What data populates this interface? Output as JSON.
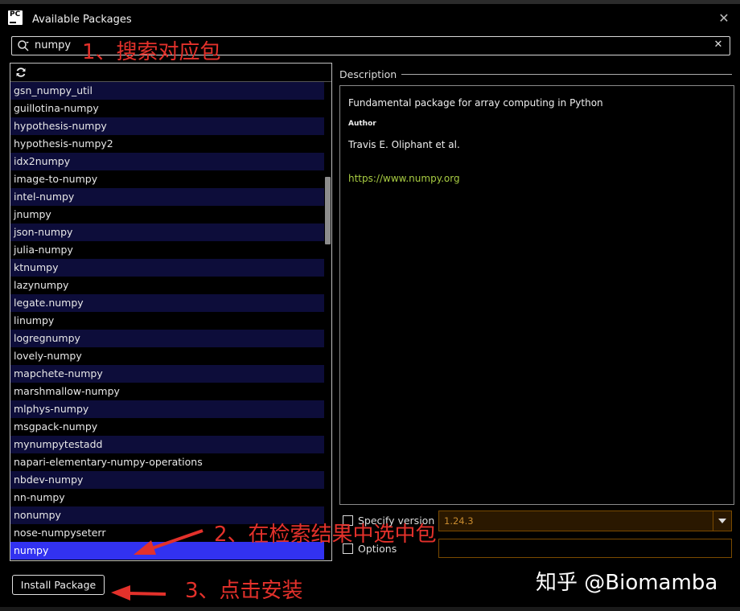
{
  "window": {
    "title": "Available Packages",
    "icon_text": "PC"
  },
  "search": {
    "value": "numpy"
  },
  "packages": [
    "gsn_numpy_util",
    "guillotina-numpy",
    "hypothesis-numpy",
    "hypothesis-numpy2",
    "idx2numpy",
    "image-to-numpy",
    "intel-numpy",
    "jnumpy",
    "json-numpy",
    "julia-numpy",
    "ktnumpy",
    "lazynumpy",
    "legate.numpy",
    "linumpy",
    "logregnumpy",
    "lovely-numpy",
    "mapchete-numpy",
    "marshmallow-numpy",
    "mlphys-numpy",
    "msgpack-numpy",
    "mynumpytestadd",
    "napari-elementary-numpy-operations",
    "nbdev-numpy",
    "nn-numpy",
    "nonumpy",
    "nose-numpyseterr",
    "numpy"
  ],
  "selected_package": "numpy",
  "description": {
    "header": "Description",
    "summary": "Fundamental package for array computing in Python",
    "author_label": "Author",
    "author": "Travis E. Oliphant et al.",
    "link": "https://www.numpy.org"
  },
  "options": {
    "specify_version_label": "Specify version",
    "version": "1.24.3",
    "options_label": "Options"
  },
  "install_button": "Install Package",
  "annotations": {
    "step1": "1、搜索对应包",
    "step2": "2、在检索结果中选中包",
    "step3": "3、点击安装"
  },
  "watermark": "知乎 @Biomamba",
  "colors": {
    "selection": "#3232f0",
    "annotation": "#e3312b",
    "link": "#a8cc42"
  }
}
